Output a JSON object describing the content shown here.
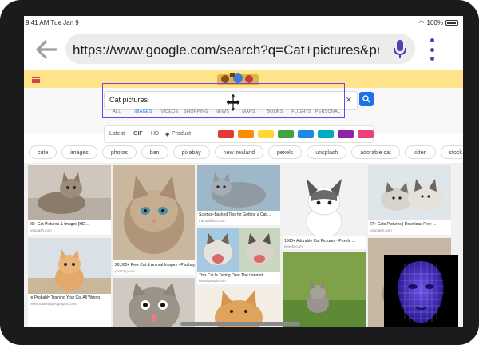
{
  "status": {
    "time": "9:41 AM  Tue Jan 9",
    "battery": "100%"
  },
  "browser": {
    "url": "https://www.google.com/search?q=Cat+pictures&prmd=ivsn&...",
    "back_icon": "back-arrow-icon",
    "mic_icon": "microphone-icon",
    "menu_icon": "more-vert-icon"
  },
  "search": {
    "query": "Cat pictures",
    "clear_label": "×",
    "tabs": [
      {
        "label": "ALL",
        "active": false
      },
      {
        "label": "IMAGES",
        "active": true
      },
      {
        "label": "VIDEOS",
        "active": false
      },
      {
        "label": "SHOPPING",
        "active": false
      },
      {
        "label": "NEWS",
        "active": false
      },
      {
        "label": "MAPS",
        "active": false
      },
      {
        "label": "BOOKS",
        "active": false
      },
      {
        "label": "FLIGHTS",
        "active": false
      },
      {
        "label": "PERSONAL",
        "active": false
      }
    ]
  },
  "filters": {
    "latest": "Latest",
    "gif": "GIF",
    "hd": "HD",
    "product": "Product",
    "colors": [
      "#e53935",
      "#fb8c00",
      "#fdd835",
      "#43a047",
      "#1e88e5",
      "#00acc1",
      "#8e24aa",
      "#ec407a"
    ]
  },
  "chips": [
    "cute",
    "images",
    "photos",
    "ban",
    "pixabay",
    "new zealand",
    "pexels",
    "unsplash",
    "adorable cat",
    "kitten",
    "stock",
    "jpg",
    "happy",
    "wallpa"
  ],
  "results": [
    {
      "caption": "20+ Cat Pictures & Images [HD ...",
      "source": "unsplash.com"
    },
    {
      "caption": "20,000+ Free Cat & Animal Images - Pixabay",
      "source": "pixabay.com"
    },
    {
      "caption": "Science-Backed Tips for Getting a Cat ...",
      "source": "mentalfloss.com"
    },
    {
      "caption": "1500+ Adorable Cat Pictures · Pexels ...",
      "source": "pexels.com"
    },
    {
      "caption": "27+ Cats Pictures | Download Free ...",
      "source": "unsplash.com"
    },
    {
      "caption": "re Probably Training Your Cat All Wrong",
      "source": "news.nationalgeographic.com"
    },
    {
      "caption": "This Cat Is Taking Over The Internet ...",
      "source": "boredpanda.com"
    }
  ],
  "colors": {
    "accent": "#1a73e8",
    "outline": "#7a3bf0",
    "menu": "#5b3cb0"
  }
}
